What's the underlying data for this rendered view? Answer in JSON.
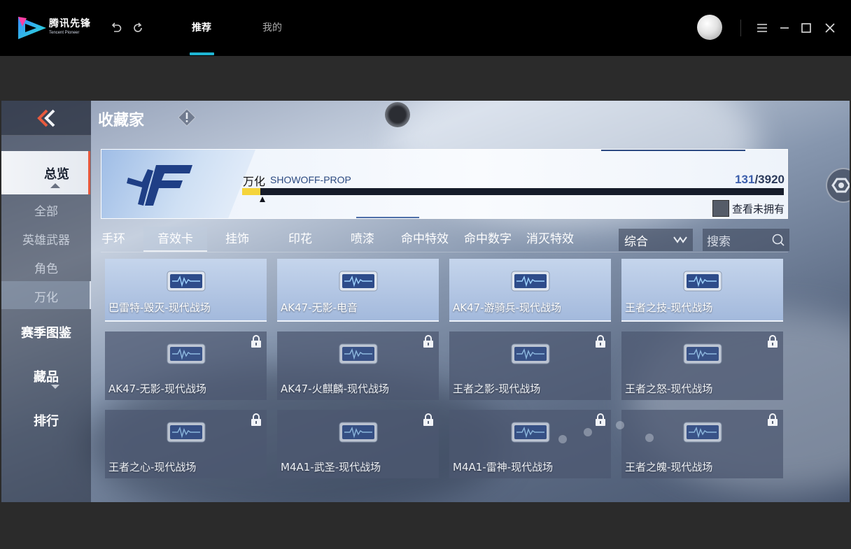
{
  "launcher": {
    "logo_cn": "腾讯先锋",
    "logo_en": "Tencent Pioneer",
    "tabs": [
      {
        "label": "推荐",
        "active": true
      },
      {
        "label": "我的",
        "active": false
      }
    ],
    "accent_color": "#1fb6d4"
  },
  "game": {
    "page_title": "收藏家",
    "sidebar": {
      "active_main": "总览",
      "sub_items": [
        "全部",
        "英雄武器",
        "角色",
        "万化"
      ],
      "selected_sub": "万化",
      "main_items": [
        "赛季图鉴",
        "藏品",
        "排行"
      ]
    },
    "banner": {
      "category_name": "万化",
      "category_code": "SHOWOFF-PROP",
      "owned": "131",
      "total": "/3920",
      "progress_fraction": 0.0334,
      "unowned_label": "查看未拥有"
    },
    "filter_tabs": [
      {
        "label": "手环",
        "selected": false
      },
      {
        "label": "音效卡",
        "selected": true
      },
      {
        "label": "挂饰",
        "selected": false
      },
      {
        "label": "印花",
        "selected": false
      },
      {
        "label": "喷漆",
        "selected": false
      },
      {
        "label": "命中特效",
        "selected": false
      },
      {
        "label": "命中数字",
        "selected": false
      },
      {
        "label": "消灭特效",
        "selected": false
      }
    ],
    "sort_value": "综合",
    "search_placeholder": "搜索",
    "cards": [
      {
        "label": "巴雷特-毁灭-现代战场",
        "locked": false
      },
      {
        "label": "AK47-无影-电音",
        "locked": false
      },
      {
        "label": "AK47-游骑兵-现代战场",
        "locked": false
      },
      {
        "label": "王者之技-现代战场",
        "locked": false
      },
      {
        "label": "AK47-无影-现代战场",
        "locked": true
      },
      {
        "label": "AK47-火麒麟-现代战场",
        "locked": true
      },
      {
        "label": "王者之影-现代战场",
        "locked": true
      },
      {
        "label": "王者之怒-现代战场",
        "locked": true
      },
      {
        "label": "王者之心-现代战场",
        "locked": true
      },
      {
        "label": "M4A1-武圣-现代战场",
        "locked": true
      },
      {
        "label": "M4A1-雷神-现代战场",
        "locked": true
      },
      {
        "label": "王者之魄-现代战场",
        "locked": true
      }
    ],
    "colors": {
      "nav_active_bar": "#e85a3e",
      "progress_fill": "#f5d43b",
      "progress_track": "#161c2a"
    }
  }
}
